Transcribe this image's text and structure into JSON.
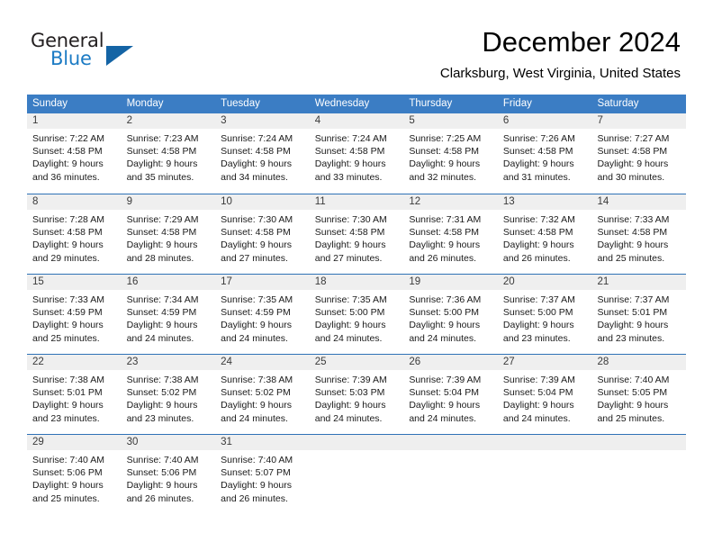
{
  "brand": {
    "word_one": "General",
    "word_two": "Blue",
    "logo_icon": "triangle-logo-icon"
  },
  "header": {
    "month_title": "December 2024",
    "location": "Clarksburg, West Virginia, United States"
  },
  "colors": {
    "header_blue": "#3b7dc4",
    "row_divider_blue": "#2f72b6",
    "date_band_gray": "#efefef",
    "brand_blue": "#1c7bc4"
  },
  "weekday_headers": [
    "Sunday",
    "Monday",
    "Tuesday",
    "Wednesday",
    "Thursday",
    "Friday",
    "Saturday"
  ],
  "weeks": [
    [
      {
        "day": "1",
        "sunrise": "Sunrise: 7:22 AM",
        "sunset": "Sunset: 4:58 PM",
        "daylight_1": "Daylight: 9 hours",
        "daylight_2": "and 36 minutes."
      },
      {
        "day": "2",
        "sunrise": "Sunrise: 7:23 AM",
        "sunset": "Sunset: 4:58 PM",
        "daylight_1": "Daylight: 9 hours",
        "daylight_2": "and 35 minutes."
      },
      {
        "day": "3",
        "sunrise": "Sunrise: 7:24 AM",
        "sunset": "Sunset: 4:58 PM",
        "daylight_1": "Daylight: 9 hours",
        "daylight_2": "and 34 minutes."
      },
      {
        "day": "4",
        "sunrise": "Sunrise: 7:24 AM",
        "sunset": "Sunset: 4:58 PM",
        "daylight_1": "Daylight: 9 hours",
        "daylight_2": "and 33 minutes."
      },
      {
        "day": "5",
        "sunrise": "Sunrise: 7:25 AM",
        "sunset": "Sunset: 4:58 PM",
        "daylight_1": "Daylight: 9 hours",
        "daylight_2": "and 32 minutes."
      },
      {
        "day": "6",
        "sunrise": "Sunrise: 7:26 AM",
        "sunset": "Sunset: 4:58 PM",
        "daylight_1": "Daylight: 9 hours",
        "daylight_2": "and 31 minutes."
      },
      {
        "day": "7",
        "sunrise": "Sunrise: 7:27 AM",
        "sunset": "Sunset: 4:58 PM",
        "daylight_1": "Daylight: 9 hours",
        "daylight_2": "and 30 minutes."
      }
    ],
    [
      {
        "day": "8",
        "sunrise": "Sunrise: 7:28 AM",
        "sunset": "Sunset: 4:58 PM",
        "daylight_1": "Daylight: 9 hours",
        "daylight_2": "and 29 minutes."
      },
      {
        "day": "9",
        "sunrise": "Sunrise: 7:29 AM",
        "sunset": "Sunset: 4:58 PM",
        "daylight_1": "Daylight: 9 hours",
        "daylight_2": "and 28 minutes."
      },
      {
        "day": "10",
        "sunrise": "Sunrise: 7:30 AM",
        "sunset": "Sunset: 4:58 PM",
        "daylight_1": "Daylight: 9 hours",
        "daylight_2": "and 27 minutes."
      },
      {
        "day": "11",
        "sunrise": "Sunrise: 7:30 AM",
        "sunset": "Sunset: 4:58 PM",
        "daylight_1": "Daylight: 9 hours",
        "daylight_2": "and 27 minutes."
      },
      {
        "day": "12",
        "sunrise": "Sunrise: 7:31 AM",
        "sunset": "Sunset: 4:58 PM",
        "daylight_1": "Daylight: 9 hours",
        "daylight_2": "and 26 minutes."
      },
      {
        "day": "13",
        "sunrise": "Sunrise: 7:32 AM",
        "sunset": "Sunset: 4:58 PM",
        "daylight_1": "Daylight: 9 hours",
        "daylight_2": "and 26 minutes."
      },
      {
        "day": "14",
        "sunrise": "Sunrise: 7:33 AM",
        "sunset": "Sunset: 4:58 PM",
        "daylight_1": "Daylight: 9 hours",
        "daylight_2": "and 25 minutes."
      }
    ],
    [
      {
        "day": "15",
        "sunrise": "Sunrise: 7:33 AM",
        "sunset": "Sunset: 4:59 PM",
        "daylight_1": "Daylight: 9 hours",
        "daylight_2": "and 25 minutes."
      },
      {
        "day": "16",
        "sunrise": "Sunrise: 7:34 AM",
        "sunset": "Sunset: 4:59 PM",
        "daylight_1": "Daylight: 9 hours",
        "daylight_2": "and 24 minutes."
      },
      {
        "day": "17",
        "sunrise": "Sunrise: 7:35 AM",
        "sunset": "Sunset: 4:59 PM",
        "daylight_1": "Daylight: 9 hours",
        "daylight_2": "and 24 minutes."
      },
      {
        "day": "18",
        "sunrise": "Sunrise: 7:35 AM",
        "sunset": "Sunset: 5:00 PM",
        "daylight_1": "Daylight: 9 hours",
        "daylight_2": "and 24 minutes."
      },
      {
        "day": "19",
        "sunrise": "Sunrise: 7:36 AM",
        "sunset": "Sunset: 5:00 PM",
        "daylight_1": "Daylight: 9 hours",
        "daylight_2": "and 24 minutes."
      },
      {
        "day": "20",
        "sunrise": "Sunrise: 7:37 AM",
        "sunset": "Sunset: 5:00 PM",
        "daylight_1": "Daylight: 9 hours",
        "daylight_2": "and 23 minutes."
      },
      {
        "day": "21",
        "sunrise": "Sunrise: 7:37 AM",
        "sunset": "Sunset: 5:01 PM",
        "daylight_1": "Daylight: 9 hours",
        "daylight_2": "and 23 minutes."
      }
    ],
    [
      {
        "day": "22",
        "sunrise": "Sunrise: 7:38 AM",
        "sunset": "Sunset: 5:01 PM",
        "daylight_1": "Daylight: 9 hours",
        "daylight_2": "and 23 minutes."
      },
      {
        "day": "23",
        "sunrise": "Sunrise: 7:38 AM",
        "sunset": "Sunset: 5:02 PM",
        "daylight_1": "Daylight: 9 hours",
        "daylight_2": "and 23 minutes."
      },
      {
        "day": "24",
        "sunrise": "Sunrise: 7:38 AM",
        "sunset": "Sunset: 5:02 PM",
        "daylight_1": "Daylight: 9 hours",
        "daylight_2": "and 24 minutes."
      },
      {
        "day": "25",
        "sunrise": "Sunrise: 7:39 AM",
        "sunset": "Sunset: 5:03 PM",
        "daylight_1": "Daylight: 9 hours",
        "daylight_2": "and 24 minutes."
      },
      {
        "day": "26",
        "sunrise": "Sunrise: 7:39 AM",
        "sunset": "Sunset: 5:04 PM",
        "daylight_1": "Daylight: 9 hours",
        "daylight_2": "and 24 minutes."
      },
      {
        "day": "27",
        "sunrise": "Sunrise: 7:39 AM",
        "sunset": "Sunset: 5:04 PM",
        "daylight_1": "Daylight: 9 hours",
        "daylight_2": "and 24 minutes."
      },
      {
        "day": "28",
        "sunrise": "Sunrise: 7:40 AM",
        "sunset": "Sunset: 5:05 PM",
        "daylight_1": "Daylight: 9 hours",
        "daylight_2": "and 25 minutes."
      }
    ],
    [
      {
        "day": "29",
        "sunrise": "Sunrise: 7:40 AM",
        "sunset": "Sunset: 5:06 PM",
        "daylight_1": "Daylight: 9 hours",
        "daylight_2": "and 25 minutes."
      },
      {
        "day": "30",
        "sunrise": "Sunrise: 7:40 AM",
        "sunset": "Sunset: 5:06 PM",
        "daylight_1": "Daylight: 9 hours",
        "daylight_2": "and 26 minutes."
      },
      {
        "day": "31",
        "sunrise": "Sunrise: 7:40 AM",
        "sunset": "Sunset: 5:07 PM",
        "daylight_1": "Daylight: 9 hours",
        "daylight_2": "and 26 minutes."
      },
      {
        "day": "",
        "sunrise": "",
        "sunset": "",
        "daylight_1": "",
        "daylight_2": ""
      },
      {
        "day": "",
        "sunrise": "",
        "sunset": "",
        "daylight_1": "",
        "daylight_2": ""
      },
      {
        "day": "",
        "sunrise": "",
        "sunset": "",
        "daylight_1": "",
        "daylight_2": ""
      },
      {
        "day": "",
        "sunrise": "",
        "sunset": "",
        "daylight_1": "",
        "daylight_2": ""
      }
    ]
  ]
}
